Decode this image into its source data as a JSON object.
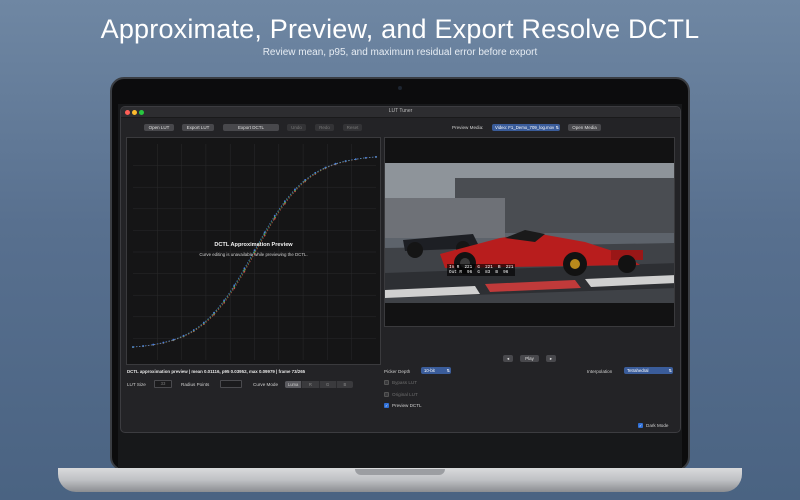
{
  "hero": {
    "headline": "Approximate, Preview, and Export Resolve DCTL",
    "subhead": "Review mean, p95, and maximum residual error before export"
  },
  "window": {
    "title": "LUT Tuner",
    "traffic_lights": {
      "close": "#ff5f57",
      "minimize": "#febc2e",
      "zoom": "#28c840"
    }
  },
  "toolbar": {
    "open_lut": "Open LUT",
    "export_lut": "Export LUT",
    "export_dctl": "Export DCTL",
    "undo": "Undo",
    "redo": "Redo",
    "reset": "Reset",
    "preview_media_label": "Preview Media:",
    "preview_media_value": "Video: F1_Demo_709_log.mov",
    "open_media": "Open Media"
  },
  "curve_plot": {
    "overlay_title": "DCTL Approximation Preview",
    "overlay_subtitle": "Curve editing is unavailable while previewing the DCTL.",
    "status": "DCTL approximation preview | mean 0.01116, p95 0.03952, max 0.09979 | frame 73/265",
    "curve_colors": [
      "#c94a4a",
      "#4caf50",
      "#4a7be0"
    ]
  },
  "controls": {
    "lut_size_label": "LUT Size",
    "lut_size_value": "33",
    "radius_points_label": "Radius Points",
    "radius_points_value": "",
    "curve_mode_label": "Curve Mode",
    "curve_mode_options": [
      "Luma",
      "R",
      "G",
      "B"
    ],
    "curve_mode_selected": "Luma"
  },
  "player": {
    "prev": "◂",
    "play": "Play",
    "next": "▸",
    "pixel_readout": {
      "in_line": "In R  221  G  221  B  221",
      "out_line": "Out R  96  G  83  B  96"
    }
  },
  "preview_options": {
    "picker_depth_label": "Picker Depth",
    "picker_depth_value": "10-bit",
    "interpolation_label": "Interpolation",
    "interpolation_value": "Tetrahedral",
    "bypass_lut_label": "Bypass LUT",
    "bypass_lut_checked": false,
    "original_lut_label": "Original LUT",
    "original_lut_checked": false,
    "preview_dctl_label": "Preview DCTL",
    "preview_dctl_checked": true,
    "dark_mode_label": "Dark Mode",
    "dark_mode_checked": true
  }
}
